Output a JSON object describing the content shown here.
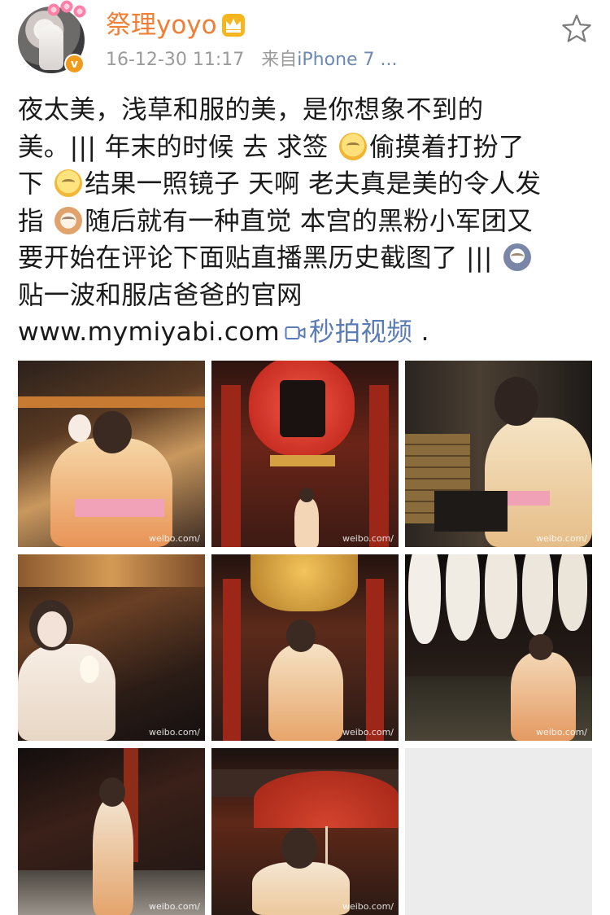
{
  "user": {
    "name": "祭理yoyo",
    "badge_glyph": "v",
    "timestamp": "16-12-30 11:17",
    "source_prefix": "来自",
    "source": "iPhone 7 ..."
  },
  "post": {
    "lines": [
      "夜太美，浅草和服的美，是你想象不到的",
      "美。|||  年末的时候 去 求签 ",
      "偷摸着打扮了",
      "下 ",
      "结果一照镜子 天啊 老夫真是美的令人发",
      "指 ",
      "随后就有一种直觉 本宫的黑粉小军团又",
      "要开始在评论下面贴直播黑历史截图了 ||| ",
      "贴一波和服店爸爸的官网"
    ],
    "url": "www.mymiyabi.com",
    "video_link": "秒拍视频",
    "trailing": " ."
  },
  "photos": [
    {
      "name": "photo-1",
      "watermark": "weibo.com/"
    },
    {
      "name": "photo-2",
      "watermark": "weibo.com/"
    },
    {
      "name": "photo-3",
      "watermark": "weibo.com/"
    },
    {
      "name": "photo-4",
      "watermark": "weibo.com/"
    },
    {
      "name": "photo-5",
      "watermark": "weibo.com/"
    },
    {
      "name": "photo-6",
      "watermark": "weibo.com/"
    },
    {
      "name": "photo-7",
      "watermark": "weibo.com/"
    },
    {
      "name": "photo-8",
      "watermark": "weibo.com/"
    }
  ],
  "icons": [
    "verified-icon",
    "crown-icon",
    "star-icon",
    "video-icon",
    "sweat-emoji",
    "think-emoji",
    "cat-emoji",
    "shock-emoji"
  ],
  "colors": {
    "username": "#f07e33",
    "link": "#5a7bb5",
    "meta": "#9b9b9b",
    "badge": "#f29a1c"
  }
}
